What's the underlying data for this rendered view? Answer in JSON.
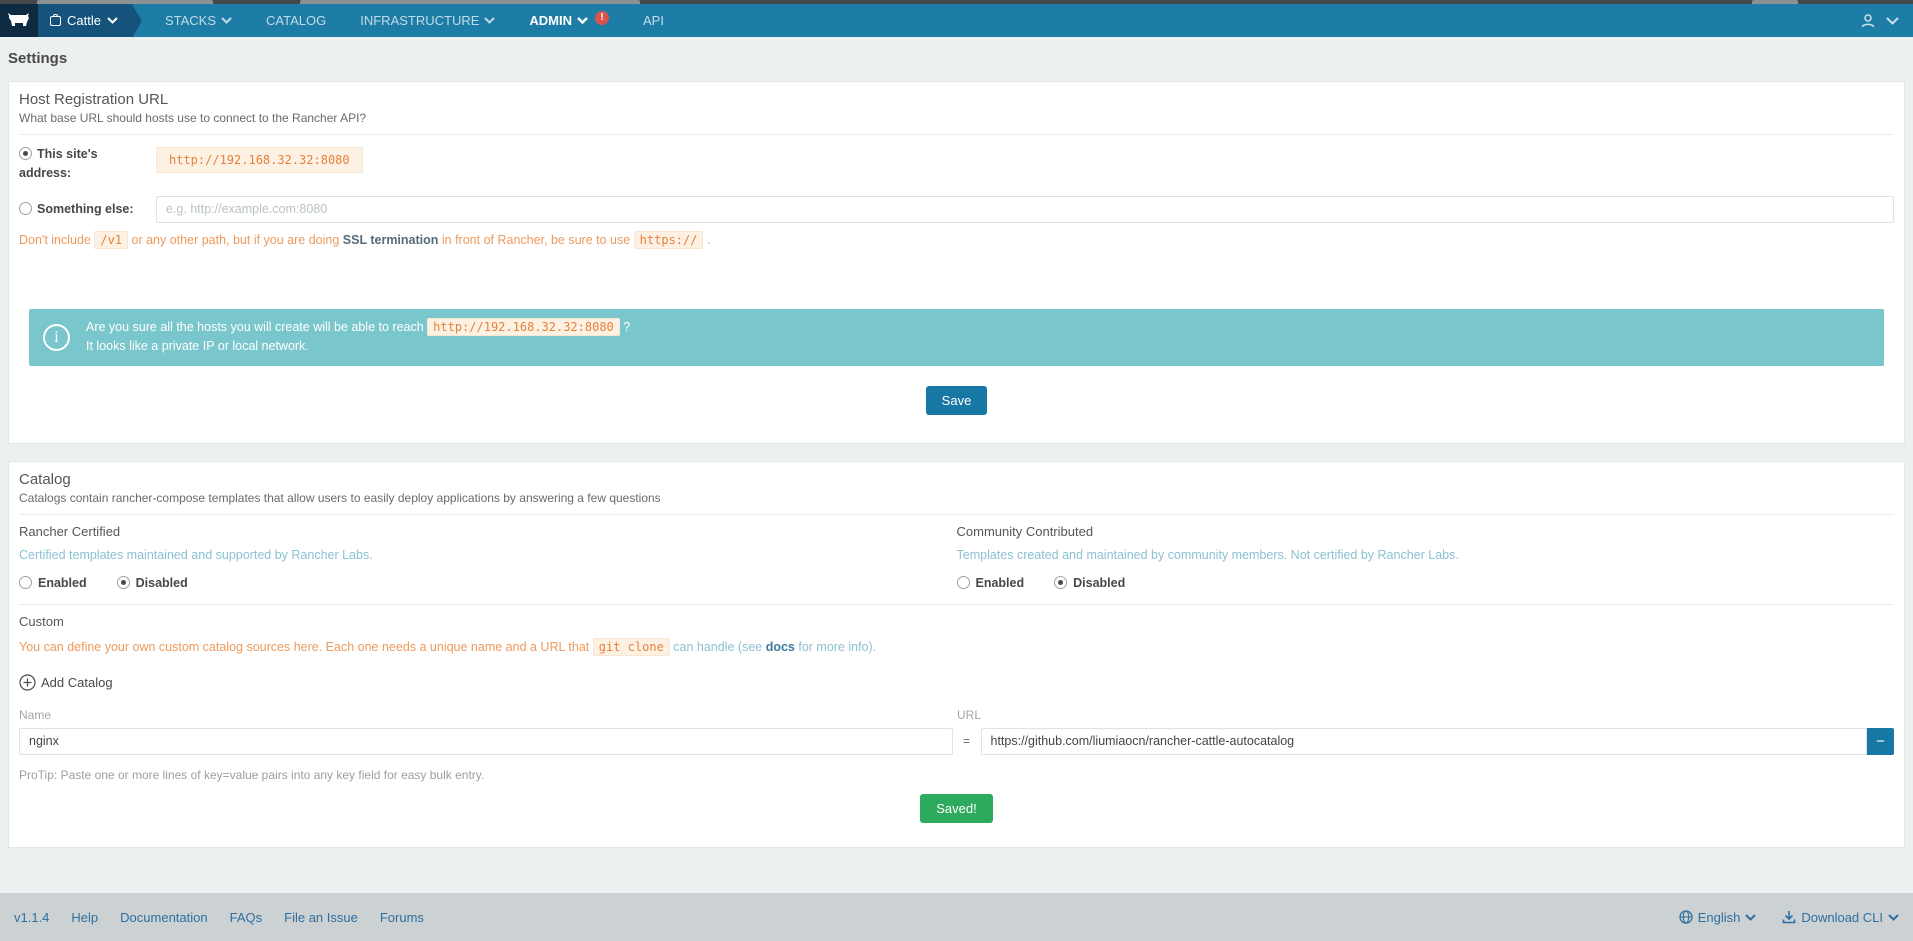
{
  "nav": {
    "environment": {
      "label": "Cattle"
    },
    "items": [
      {
        "label": "STACKS"
      },
      {
        "label": "CATALOG"
      },
      {
        "label": "INFRASTRUCTURE"
      },
      {
        "label": "ADMIN",
        "badge": "!"
      },
      {
        "label": "API"
      }
    ]
  },
  "page": {
    "title": "Settings"
  },
  "host_registration": {
    "title": "Host Registration URL",
    "subtitle": "What base URL should hosts use to connect to the Rancher API?",
    "option_site": {
      "label": "This site's address:",
      "value": "http://192.168.32.32:8080",
      "selected": true
    },
    "option_else": {
      "label": "Something else:",
      "placeholder": "e.g. http://example.com:8080",
      "selected": false
    },
    "note": {
      "part1": "Don't include ",
      "code1": "/v1",
      "part2": " or any other path, but if you are doing ",
      "bold": "SSL termination",
      "part3": " in front of Rancher, be sure to use ",
      "code2": "https://",
      "part4": " ."
    },
    "banner": {
      "line1_prefix": "Are you sure all the hosts you will create will be able to reach ",
      "line1_code": "http://192.168.32.32:8080",
      "line1_suffix": " ?",
      "line2": "It looks like a private IP or local network."
    },
    "save_label": "Save"
  },
  "catalog": {
    "title": "Catalog",
    "subtitle": "Catalogs contain rancher-compose templates that allow users to easily deploy applications by answering a few questions",
    "rancher_certified": {
      "title": "Rancher Certified",
      "description": "Certified templates maintained and supported by Rancher Labs.",
      "enabled_label": "Enabled",
      "disabled_label": "Disabled",
      "selected": "Disabled"
    },
    "community": {
      "title": "Community Contributed",
      "description": "Templates created and maintained by community members. Not certified by Rancher Labs.",
      "enabled_label": "Enabled",
      "disabled_label": "Disabled",
      "selected": "Disabled"
    },
    "custom": {
      "title": "Custom",
      "note_part1": "You can define your own custom catalog sources here. Each one needs a unique name and a URL that ",
      "note_code": "git clone",
      "note_part2": " can handle (see ",
      "note_link": "docs",
      "note_part3": " for more info).",
      "add_label": "Add Catalog",
      "name_label": "Name",
      "url_label": "URL",
      "equals": "=",
      "entry": {
        "name": "nginx",
        "url": "https://github.com/liumiaocn/rancher-cattle-autocatalog"
      },
      "remove_label": "−",
      "protip": "ProTip: Paste one or more lines of key=value pairs into any key field for easy bulk entry.",
      "saved_label": "Saved!"
    }
  },
  "footer": {
    "version": "v1.1.4",
    "links": [
      "Help",
      "Documentation",
      "FAQs",
      "File an Issue",
      "Forums"
    ],
    "language": "English",
    "download": "Download CLI"
  },
  "colors": {
    "nav_bg": "#1e7da6",
    "nav_logo_bg": "#0d2a40",
    "nav_env_bg": "#15527c",
    "banner_bg": "#79c6cc",
    "accent_blue": "#1777a5",
    "success_green": "#2cab5e",
    "alert_red": "#d9534f",
    "code_orange": "#e5823d",
    "warn_orange": "#ee9a5c",
    "muted_teal": "#8bc1d2",
    "footer_bg": "#ccd1d3",
    "footer_link": "#2f6f9f"
  }
}
